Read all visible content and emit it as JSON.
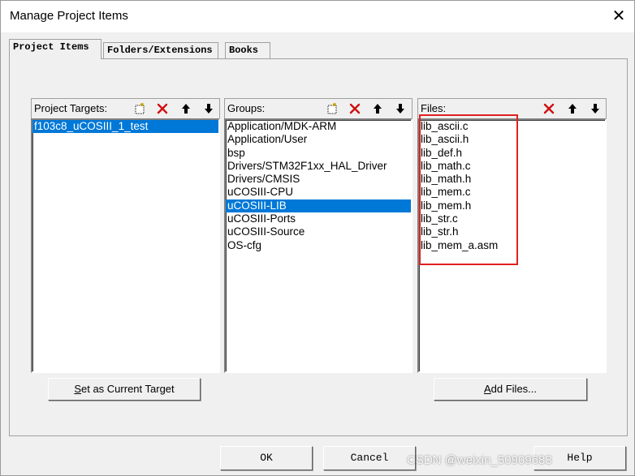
{
  "window": {
    "title": "Manage Project Items",
    "close_glyph": "✕"
  },
  "tabs": [
    {
      "label": "Project Items",
      "active": true
    },
    {
      "label": "Folders/Extensions",
      "active": false
    },
    {
      "label": "Books",
      "active": false
    }
  ],
  "targets": {
    "header": "Project Targets:",
    "items": [
      "f103c8_uCOSIII_1_test"
    ],
    "selected_index": 0
  },
  "groups": {
    "header": "Groups:",
    "items": [
      "Application/MDK-ARM",
      "Application/User",
      "bsp",
      "Drivers/STM32F1xx_HAL_Driver",
      "Drivers/CMSIS",
      "uCOSIII-CPU",
      "uCOSIII-LIB",
      "uCOSIII-Ports",
      "uCOSIII-Source",
      "OS-cfg"
    ],
    "selected_index": 6
  },
  "files": {
    "header": "Files:",
    "items": [
      "lib_ascii.c",
      "lib_ascii.h",
      "lib_def.h",
      "lib_math.c",
      "lib_math.h",
      "lib_mem.c",
      "lib_mem.h",
      "lib_str.c",
      "lib_str.h",
      "lib_mem_a.asm"
    ]
  },
  "buttons": {
    "set_target_accel": "S",
    "set_target_rest": "et as Current Target",
    "add_files_accel": "A",
    "add_files_rest": "dd Files...",
    "ok": "OK",
    "cancel": "Cancel",
    "help": "Help"
  },
  "icons": [
    "new-icon",
    "delete-icon",
    "move-up-icon",
    "move-down-icon"
  ],
  "colors": {
    "selection": "#0078d7",
    "annotation": "#e02020"
  },
  "watermark": "https://blog.csdn.net/weixin_50909683",
  "watermark_visible": "CSDN @weixin_50909683"
}
